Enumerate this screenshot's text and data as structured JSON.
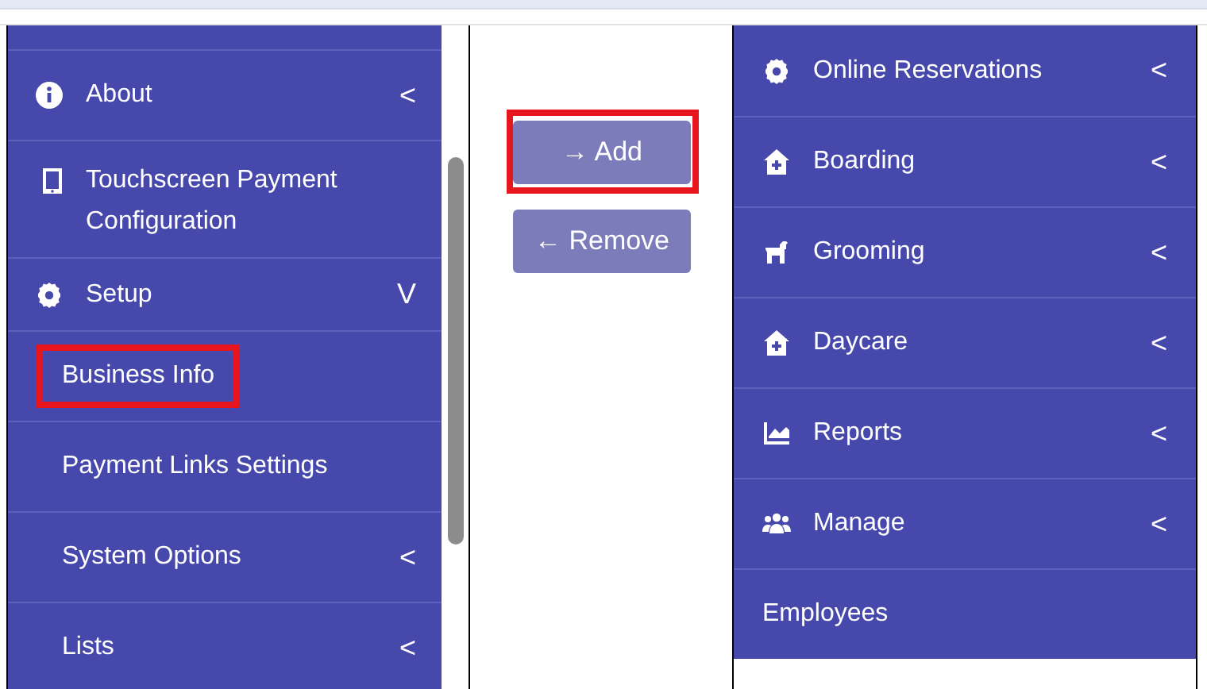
{
  "left_menu": {
    "items": [
      {
        "label": "About",
        "chevron": "<",
        "highlighted": false
      },
      {
        "label": "Touchscreen Payment Configuration",
        "highlighted": false
      },
      {
        "label": "Setup",
        "chevron": "V",
        "highlighted": false,
        "children": [
          {
            "label": "Business Info",
            "highlighted": true
          },
          {
            "label": "Payment Links Settings",
            "highlighted": false
          },
          {
            "label": "System Options",
            "chevron": "<",
            "highlighted": false
          },
          {
            "label": "Lists",
            "chevron": "<",
            "highlighted": false
          }
        ]
      }
    ]
  },
  "buttons": [
    {
      "arrow": "→",
      "label": "Add",
      "highlighted": true
    },
    {
      "arrow": "←",
      "label": "Remove",
      "highlighted": false
    }
  ],
  "right_menu": {
    "items": [
      {
        "label": "Online Reservations",
        "chevron": "<"
      },
      {
        "label": "Boarding",
        "chevron": "<"
      },
      {
        "label": "Grooming",
        "chevron": "<"
      },
      {
        "label": "Daycare",
        "chevron": "<"
      },
      {
        "label": "Reports",
        "chevron": "<"
      },
      {
        "label": "Manage",
        "chevron": "<"
      },
      {
        "label": "Employees"
      }
    ]
  }
}
